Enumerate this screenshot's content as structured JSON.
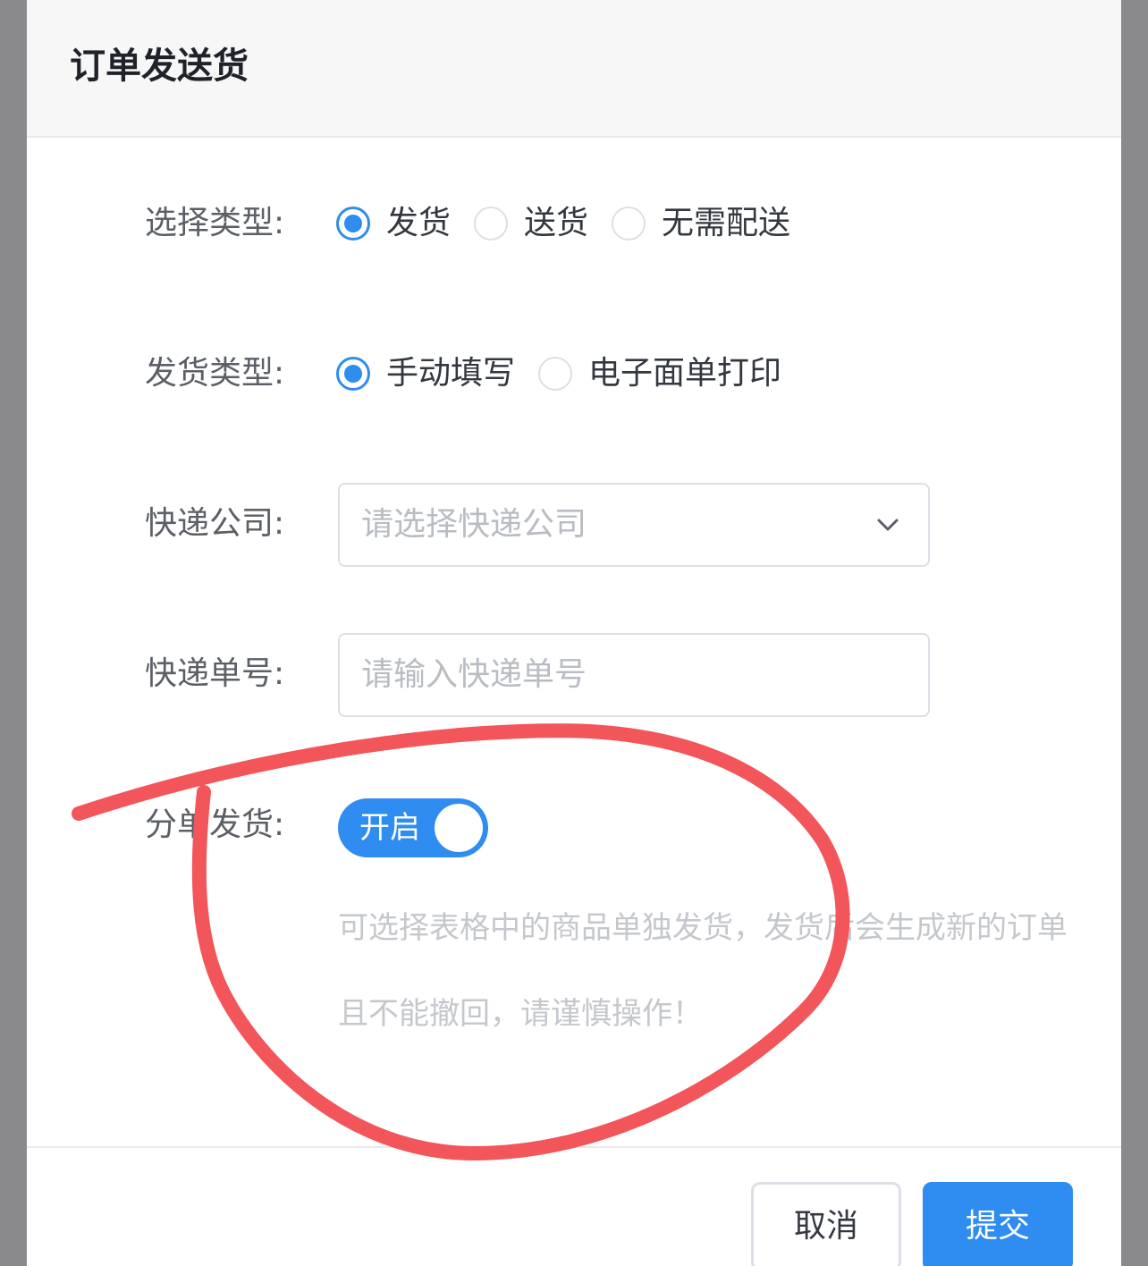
{
  "dialog": {
    "title": "订单发送货"
  },
  "form": {
    "select_type": {
      "label": "选择类型:",
      "options": [
        "发货",
        "送货",
        "无需配送"
      ],
      "selected": "发货"
    },
    "ship_type": {
      "label": "发货类型:",
      "options": [
        "手动填写",
        "电子面单打印"
      ],
      "selected": "手动填写"
    },
    "courier": {
      "label": "快递公司:",
      "placeholder": "请选择快递公司"
    },
    "tracking": {
      "label": "快递单号:",
      "placeholder": "请输入快递单号"
    },
    "split": {
      "label": "分单发货:",
      "switch_text": "开启",
      "enabled": true,
      "tip": "可选择表格中的商品单独发货，发货后会生成新的订单且不能撤回，请谨慎操作！"
    }
  },
  "footer": {
    "cancel_label": "取消",
    "submit_label": "提交"
  },
  "colors": {
    "primary": "#2f8cf0",
    "annotation": "#f2555a"
  }
}
